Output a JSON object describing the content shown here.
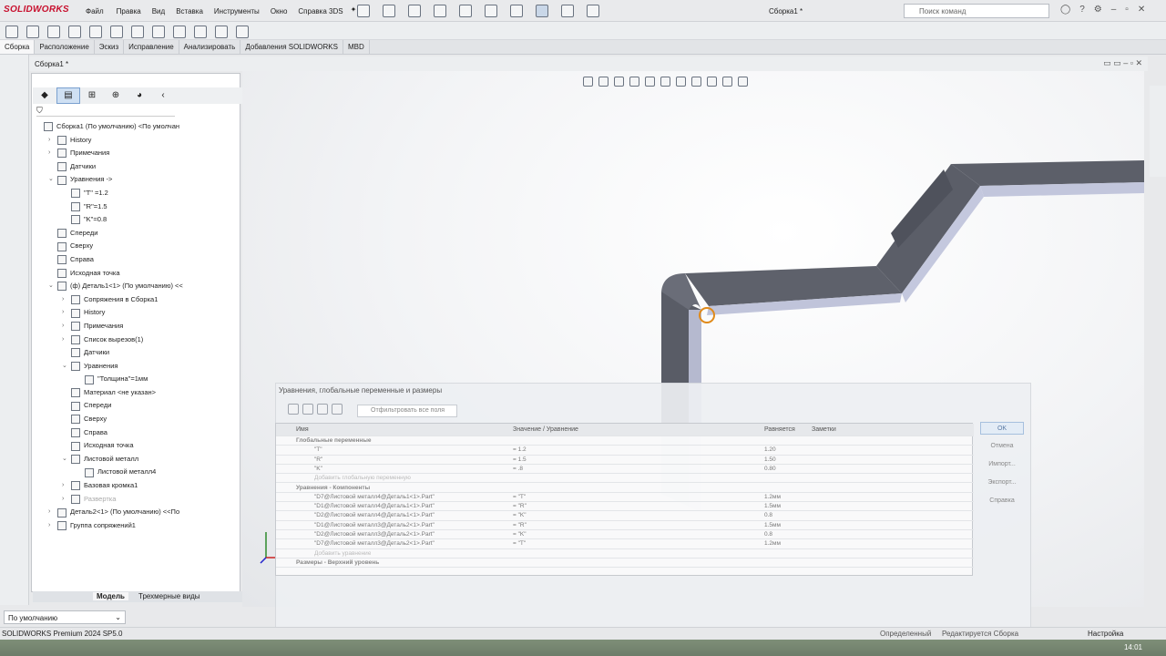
{
  "app": {
    "logo": "SOLIDWORKS",
    "doc_title": "Сборка1 *",
    "search_placeholder": "Поиск команд"
  },
  "menu": [
    "Файл",
    "Правка",
    "Вид",
    "Вставка",
    "Инструменты",
    "Окно",
    "Справка 3DS"
  ],
  "tabs": [
    "Сборка",
    "Расположение",
    "Эскиз",
    "Исправление",
    "Анализировать",
    "Добавления SOLIDWORKS",
    "MBD"
  ],
  "doc_tab": "Сборка1 *",
  "tree": [
    {
      "label": "Сборка1 (По умолчанию) <По умолчан",
      "level": 0,
      "tw": ""
    },
    {
      "label": "History",
      "level": 1,
      "tw": "›"
    },
    {
      "label": "Примечания",
      "level": 1,
      "tw": "›"
    },
    {
      "label": "Датчики",
      "level": 1,
      "tw": ""
    },
    {
      "label": "Уравнения ->",
      "level": 1,
      "tw": "⌄"
    },
    {
      "label": "\"T\" =1.2",
      "level": 2,
      "tw": ""
    },
    {
      "label": "\"R\"=1.5",
      "level": 2,
      "tw": ""
    },
    {
      "label": "\"K\"=0.8",
      "level": 2,
      "tw": ""
    },
    {
      "label": "Спереди",
      "level": 1,
      "tw": ""
    },
    {
      "label": "Сверху",
      "level": 1,
      "tw": ""
    },
    {
      "label": "Справа",
      "level": 1,
      "tw": ""
    },
    {
      "label": "Исходная точка",
      "level": 1,
      "tw": ""
    },
    {
      "label": "(ф) Деталь1<1> (По умолчанию) <<",
      "level": 1,
      "tw": "⌄"
    },
    {
      "label": "Сопряжения в Сборка1",
      "level": 2,
      "tw": "›"
    },
    {
      "label": "History",
      "level": 2,
      "tw": "›"
    },
    {
      "label": "Примечания",
      "level": 2,
      "tw": "›"
    },
    {
      "label": "Список вырезов(1)",
      "level": 2,
      "tw": "›"
    },
    {
      "label": "Датчики",
      "level": 2,
      "tw": ""
    },
    {
      "label": "Уравнения",
      "level": 2,
      "tw": "⌄"
    },
    {
      "label": "\"Толщина\"=1мм",
      "level": 3,
      "tw": ""
    },
    {
      "label": "Материал <не указан>",
      "level": 2,
      "tw": ""
    },
    {
      "label": "Спереди",
      "level": 2,
      "tw": ""
    },
    {
      "label": "Сверху",
      "level": 2,
      "tw": ""
    },
    {
      "label": "Справа",
      "level": 2,
      "tw": ""
    },
    {
      "label": "Исходная точка",
      "level": 2,
      "tw": ""
    },
    {
      "label": "Листовой металл",
      "level": 2,
      "tw": "⌄"
    },
    {
      "label": "Листовой металл4",
      "level": 3,
      "tw": ""
    },
    {
      "label": "Базовая кромка1",
      "level": 2,
      "tw": "›"
    },
    {
      "label": "Развертка",
      "level": 2,
      "tw": "›",
      "dim": true
    },
    {
      "label": "Деталь2<1> (По умолчанию) <<По",
      "level": 1,
      "tw": "›"
    },
    {
      "label": "Группа сопряжений1",
      "level": 1,
      "tw": "›"
    }
  ],
  "bottom_tabs": [
    "Модель",
    "Трехмерные виды"
  ],
  "config_dropdown": "По умолчанию",
  "dialog": {
    "title": "Уравнения, глобальные переменные и размеры",
    "filter_placeholder": "Отфильтровать все поля",
    "columns": [
      "Имя",
      "Значение / Уравнение",
      "Равняется",
      "Заметки"
    ],
    "buttons": [
      "OK",
      "Отмена",
      "Импорт...",
      "Экспорт...",
      "Справка"
    ],
    "rows": [
      {
        "type": "section",
        "name": "Глобальные переменные"
      },
      {
        "name": "\"T\"",
        "value": "= 1.2",
        "eval": "1.20"
      },
      {
        "name": "\"R\"",
        "value": "= 1.5",
        "eval": "1.50"
      },
      {
        "name": "\"K\"",
        "value": "= .8",
        "eval": "0.80"
      },
      {
        "name": "Добавить глобальную переменную",
        "value": "",
        "eval": "",
        "hint": true
      },
      {
        "type": "section",
        "name": "Уравнения - Компоненты"
      },
      {
        "name": "\"D7@Листовой металл4@Деталь1<1>.Part\"",
        "value": "= \"T\"",
        "eval": "1.2мм"
      },
      {
        "name": "\"D1@Листовой металл4@Деталь1<1>.Part\"",
        "value": "= \"R\"",
        "eval": "1.5мм"
      },
      {
        "name": "\"D2@Листовой металл4@Деталь1<1>.Part\"",
        "value": "= \"K\"",
        "eval": "0.8"
      },
      {
        "name": "\"D1@Листовой металл3@Деталь2<1>.Part\"",
        "value": "= \"R\"",
        "eval": "1.5мм"
      },
      {
        "name": "\"D2@Листовой металл3@Деталь2<1>.Part\"",
        "value": "= \"K\"",
        "eval": "0.8"
      },
      {
        "name": "\"D7@Листовой металл3@Деталь2<1>.Part\"",
        "value": "= \"T\"",
        "eval": "1.2мм"
      },
      {
        "name": "Добавить уравнение",
        "value": "",
        "eval": "",
        "hint": true
      },
      {
        "type": "section",
        "name": "Размеры - Верхний уровень"
      }
    ]
  },
  "status": {
    "left": "SOLIDWORKS Premium 2024 SP5.0",
    "mid1": "Определенный",
    "mid2": "Редактируется Сборка",
    "right": "Настройка"
  },
  "clock": "14:01"
}
